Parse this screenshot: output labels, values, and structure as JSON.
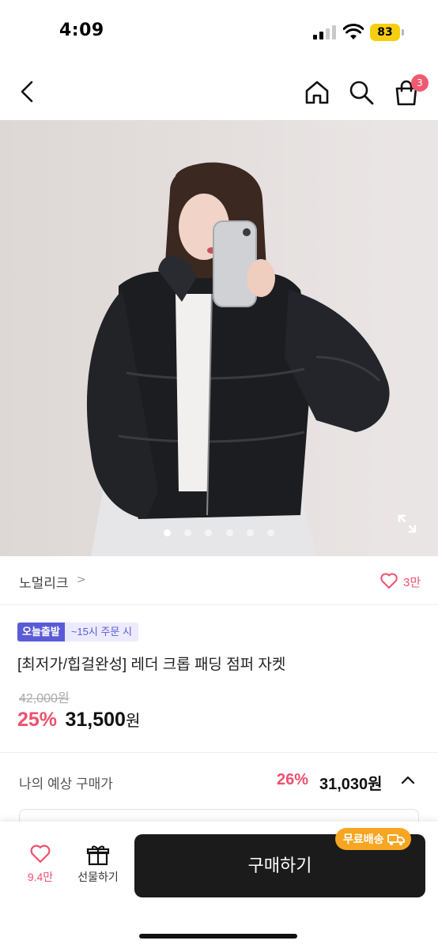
{
  "status_bar": {
    "time": "4:09",
    "battery": "83",
    "battery_color": "#f5cf0f"
  },
  "nav": {
    "back_icon": "chevron-left-icon",
    "home_icon": "home-icon",
    "search_icon": "search-icon",
    "cart_icon": "shopping-bag-icon",
    "cart_badge": "3"
  },
  "gallery": {
    "image_count": 6,
    "active_index": 0,
    "expand_icon": "expand-icon"
  },
  "brand": {
    "name": "노멀리크",
    "chevron": ">",
    "like_count": "3만"
  },
  "product": {
    "tag_primary": "오늘출발",
    "tag_secondary": "~15시 주문 시",
    "title": "[최저가/힙걸완성] 레더 크롭 패딩 점퍼 자켓",
    "original_price": "42,000원",
    "discount": "25%",
    "sale_price": "31,500",
    "currency": "원"
  },
  "expected": {
    "label": "나의 예상 구매가",
    "discount": "26%",
    "price": "31,030원"
  },
  "bottom_bar": {
    "wish_count": "9.4만",
    "gift_label": "선물하기",
    "buy_label": "구매하기",
    "free_shipping": "무료배송"
  },
  "colors": {
    "accent_pink": "#f0506e",
    "tag_purple": "#5b5bd6",
    "buy_button": "#1b1b1b",
    "free_ship_orange": "#f6a623"
  }
}
